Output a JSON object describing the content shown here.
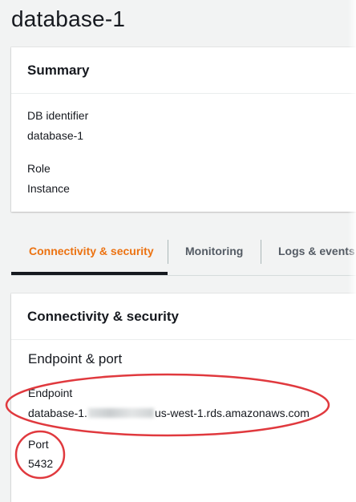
{
  "page": {
    "title": "database-1"
  },
  "summary": {
    "header": "Summary",
    "fields": [
      {
        "label": "DB identifier",
        "value": "database-1"
      },
      {
        "label": "Role",
        "value": "Instance"
      }
    ]
  },
  "tabs": [
    {
      "label": "Connectivity & security",
      "active": true
    },
    {
      "label": "Monitoring",
      "active": false
    },
    {
      "label": "Logs & events",
      "active": false
    }
  ],
  "connectivity": {
    "header": "Connectivity & security",
    "section_title": "Endpoint & port",
    "endpoint": {
      "label": "Endpoint",
      "prefix": "database-1.",
      "suffix": "us-west-1.rds.amazonaws.com"
    },
    "port": {
      "label": "Port",
      "value": "5432"
    }
  },
  "colors": {
    "active_tab": "#ec7211",
    "annotation": "#e0393e",
    "background": "#f2f3f3"
  }
}
